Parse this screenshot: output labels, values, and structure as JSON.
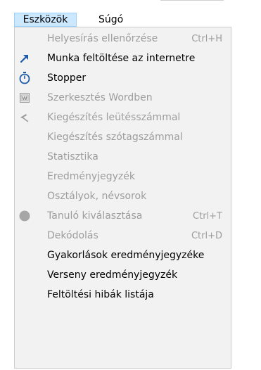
{
  "menubar": {
    "items": [
      {
        "label": "Eszközök"
      },
      {
        "label": "Súgó"
      }
    ]
  },
  "dropdown": {
    "items": [
      {
        "label": "Helyesírás ellenőrzése",
        "shortcut": "Ctrl+H",
        "enabled": false,
        "icon": ""
      },
      {
        "label": "Munka feltöltése az internetre",
        "shortcut": "",
        "enabled": true,
        "icon": "upload-arrow-icon"
      },
      {
        "label": "Stopper",
        "shortcut": "",
        "enabled": true,
        "icon": "stopwatch-icon"
      },
      {
        "label": "Szerkesztés Wordben",
        "shortcut": "",
        "enabled": false,
        "icon": "word-document-icon"
      },
      {
        "label": "Kiegészítés leütésszámmal",
        "shortcut": "",
        "enabled": false,
        "icon": "hammer-icon"
      },
      {
        "label": "Kiegészítés szótagszámmal",
        "shortcut": "",
        "enabled": false,
        "icon": ""
      },
      {
        "label": "Statisztika",
        "shortcut": "",
        "enabled": false,
        "icon": ""
      },
      {
        "label": "Eredményjegyzék",
        "shortcut": "",
        "enabled": false,
        "icon": ""
      },
      {
        "label": "Osztályok, névsorok",
        "shortcut": "",
        "enabled": false,
        "icon": ""
      },
      {
        "label": "Tanuló kiválasztása",
        "shortcut": "Ctrl+T",
        "enabled": false,
        "icon": "gray-circle-icon"
      },
      {
        "label": "Dekódolás",
        "shortcut": "Ctrl+D",
        "enabled": false,
        "icon": ""
      },
      {
        "label": "Gyakorlások eredményjegyzéke",
        "shortcut": "",
        "enabled": true,
        "icon": ""
      },
      {
        "label": "Verseny eredményjegyzék",
        "shortcut": "",
        "enabled": true,
        "icon": ""
      },
      {
        "label": "Feltöltési hibák listája",
        "shortcut": "",
        "enabled": true,
        "icon": ""
      }
    ]
  },
  "colors": {
    "menu_background": "#f2f2f2",
    "active_menubar_bg": "#cce8ff",
    "disabled_text": "#9d9d9d",
    "enabled_text": "#000000",
    "accent_blue": "#1e5aa8"
  }
}
